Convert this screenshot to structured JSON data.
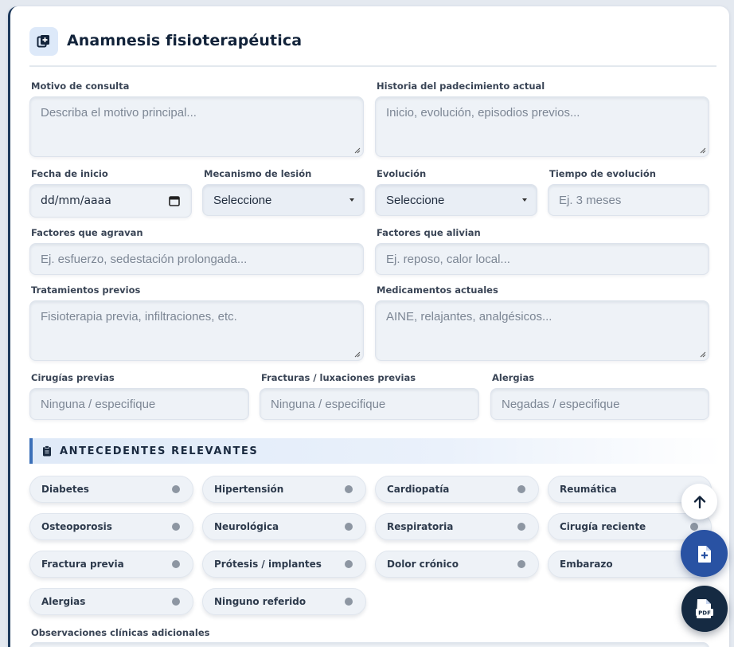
{
  "header": {
    "title": "Anamnesis fisioterapéutica",
    "icon": "add-document-icon"
  },
  "form": {
    "motivo": {
      "label": "Motivo de consulta",
      "placeholder": "Describa el motivo principal..."
    },
    "historia": {
      "label": "Historia del padecimiento actual",
      "placeholder": "Inicio, evolución, episodios previos..."
    },
    "fecha": {
      "label": "Fecha de inicio",
      "value": "dd/mm/aaaa"
    },
    "mecanismo": {
      "label": "Mecanismo de lesión",
      "value": "Seleccione"
    },
    "evolucion": {
      "label": "Evolución",
      "value": "Seleccione"
    },
    "tiempo": {
      "label": "Tiempo de evolución",
      "placeholder": "Ej. 3 meses"
    },
    "agravan": {
      "label": "Factores que agravan",
      "placeholder": "Ej. esfuerzo, sedestación prolongada..."
    },
    "alivian": {
      "label": "Factores que alivian",
      "placeholder": "Ej. reposo, calor local..."
    },
    "tratamientos": {
      "label": "Tratamientos previos",
      "placeholder": "Fisioterapia previa, infiltraciones, etc."
    },
    "medicamentos": {
      "label": "Medicamentos actuales",
      "placeholder": "AINE, relajantes, analgésicos..."
    },
    "cirugias": {
      "label": "Cirugías previas",
      "placeholder": "Ninguna / especifique"
    },
    "fracturas": {
      "label": "Fracturas / luxaciones previas",
      "placeholder": "Ninguna / especifique"
    },
    "alergias": {
      "label": "Alergias",
      "placeholder": "Negadas / especifique"
    }
  },
  "antecedentes": {
    "title": "ANTECEDENTES RELEVANTES",
    "items": [
      "Diabetes",
      "Hipertensión",
      "Cardiopatía",
      "Reumática",
      "Osteoporosis",
      "Neurológica",
      "Respiratoria",
      "Cirugía reciente",
      "Fractura previa",
      "Prótesis / implantes",
      "Dolor crónico",
      "Embarazo",
      "Alergias",
      "Ninguno referido"
    ]
  },
  "observaciones": {
    "label": "Observaciones clínicas adicionales"
  },
  "fabs": {
    "up": "arrow-up-icon",
    "add": "add-file-icon",
    "pdf": "pdf-file-icon"
  },
  "colors": {
    "accent": "#3a6fb8",
    "navy": "#12233a",
    "fab_blue": "#2952a3"
  }
}
